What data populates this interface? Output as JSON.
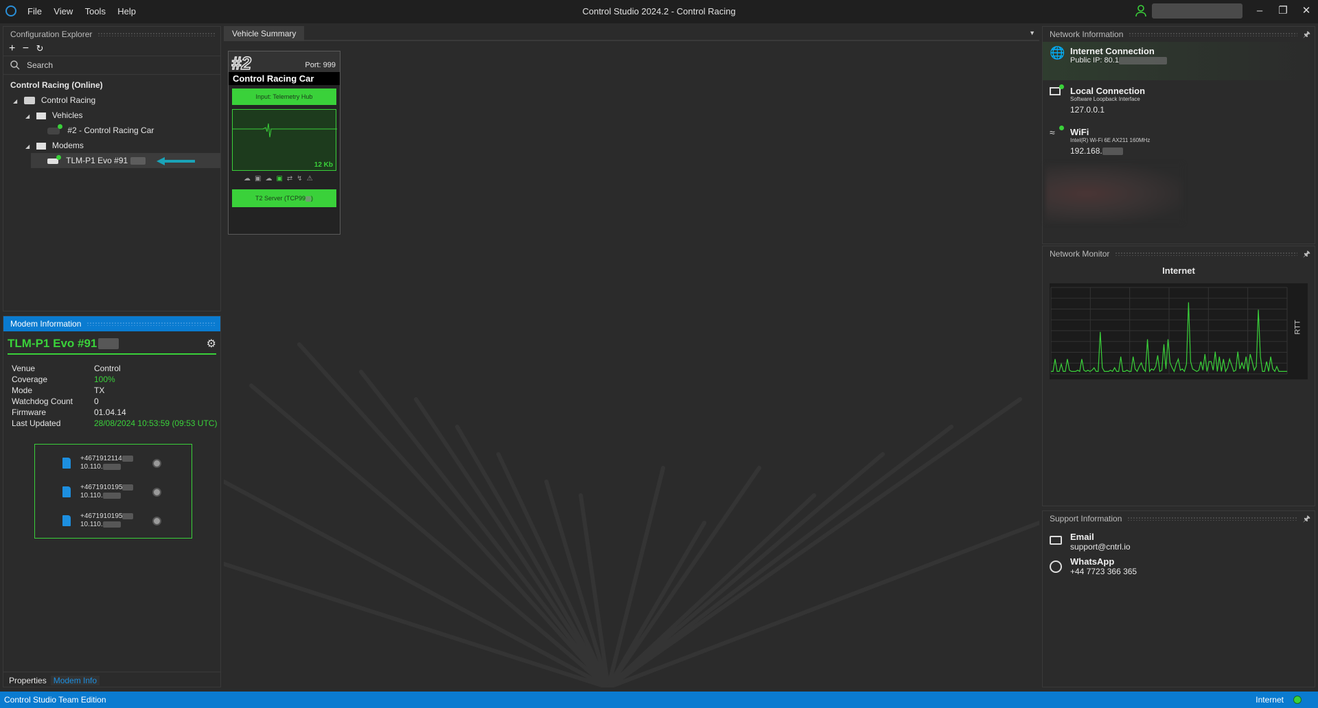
{
  "window": {
    "title": "Control Studio 2024.2 - Control Racing",
    "menu": [
      "File",
      "View",
      "Tools",
      "Help"
    ]
  },
  "config_explorer": {
    "header": "Configuration Explorer",
    "search_placeholder": "Search",
    "root_label": "Control Racing (Online)",
    "tree": {
      "org": "Control Racing",
      "vehicles_folder": "Vehicles",
      "vehicle": "#2 - Control Racing Car",
      "modems_folder": "Modems",
      "modem": "TLM-P1 Evo #91"
    }
  },
  "modem_info": {
    "header": "Modem Information",
    "name": "TLM-P1 Evo #91",
    "fields": [
      {
        "key": "Venue",
        "value": "Control",
        "green": false
      },
      {
        "key": "Coverage",
        "value": "100%",
        "green": true
      },
      {
        "key": "Mode",
        "value": "TX",
        "green": false
      },
      {
        "key": "Watchdog Count",
        "value": "0",
        "green": false
      },
      {
        "key": "Firmware",
        "value": "01.04.14",
        "green": false
      },
      {
        "key": "Last Updated",
        "value": "28/08/2024 10:53:59 (09:53 UTC)",
        "green": true
      }
    ],
    "sims": [
      {
        "phone": "+4671912114",
        "ip": "10.110."
      },
      {
        "phone": "+4671910195",
        "ip": "10.110."
      },
      {
        "phone": "+4671910195",
        "ip": "10.110."
      }
    ]
  },
  "bottom_tabs": [
    "Properties",
    "Modem Info"
  ],
  "vehicle_summary": {
    "tab": "Vehicle Summary",
    "number": "#2",
    "port": "Port: 999",
    "car_name": "Control Racing Car",
    "input_label": "Input: Telemetry Hub",
    "traffic": "12 Kb",
    "server_label": "T2 Server (TCP99"
  },
  "network_info": {
    "header": "Network Information",
    "internet": {
      "title": "Internet Connection",
      "value": "Public IP: 80.1"
    },
    "local": {
      "title": "Local Connection",
      "sub": "Software Loopback Interface",
      "value": "127.0.0.1"
    },
    "wifi": {
      "title": "WiFi",
      "sub": "Intel(R) Wi-Fi 6E AX211 160MHz",
      "value": "192.168."
    }
  },
  "network_monitor": {
    "header": "Network Monitor",
    "chart_title": "Internet",
    "y_label": "RTT"
  },
  "chart_data": {
    "type": "line",
    "title": "Internet",
    "ylabel": "RTT",
    "xlabel": "",
    "series": [
      {
        "values": [
          2,
          2,
          12,
          2,
          2,
          8,
          2,
          2,
          12,
          3,
          2,
          2,
          2,
          3,
          2,
          12,
          3,
          2,
          3,
          2,
          3,
          5,
          2,
          2,
          34,
          5,
          2,
          2,
          2,
          3,
          2,
          5,
          2,
          2,
          14,
          2,
          2,
          3,
          2,
          2,
          14,
          4,
          2,
          6,
          9,
          4,
          2,
          28,
          2,
          4,
          3,
          6,
          15,
          2,
          3,
          24,
          4,
          28,
          9,
          5,
          2,
          8,
          12,
          3,
          4,
          2,
          8,
          58,
          10,
          4,
          3,
          2,
          3,
          10,
          3,
          16,
          2,
          10,
          10,
          3,
          18,
          2,
          14,
          2,
          12,
          2,
          5,
          12,
          7,
          2,
          3,
          18,
          4,
          9,
          4,
          14,
          2,
          16,
          10,
          3,
          6,
          52,
          14,
          2,
          2,
          10,
          2,
          14,
          4,
          2,
          6,
          2,
          2,
          2,
          2,
          2
        ]
      }
    ],
    "ylim": [
      0,
      70
    ],
    "grid": true,
    "color": "#3ad13a"
  },
  "support_info": {
    "header": "Support Information",
    "email_title": "Email",
    "email_value": "support@cntrl.io",
    "whatsapp_title": "WhatsApp",
    "whatsapp_value": "+44 7723 366 365"
  },
  "statusbar": {
    "left": "Control Studio Team Edition",
    "right": "Internet"
  }
}
